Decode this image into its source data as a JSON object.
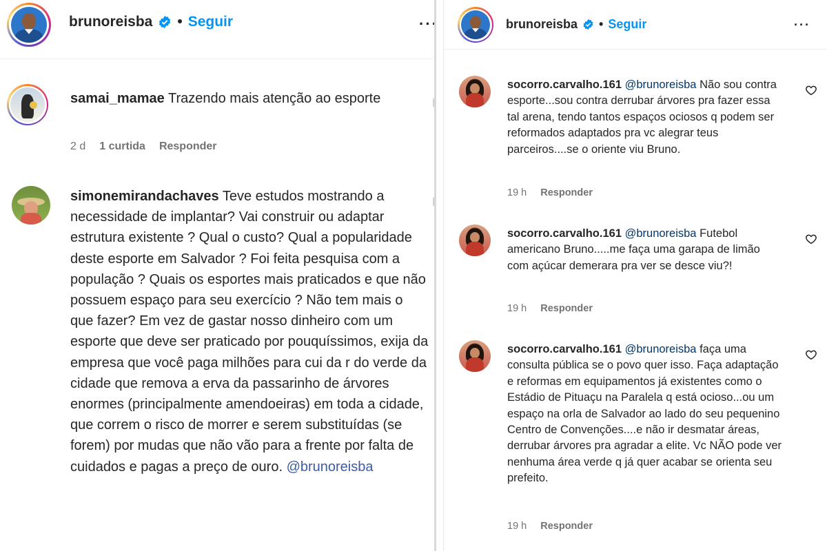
{
  "left": {
    "header": {
      "username": "brunoreisba",
      "dot": "•",
      "follow_label": "Seguir",
      "more": "···"
    },
    "comments": [
      {
        "username": "samai_mamae",
        "text": "Trazendo mais atenção ao esporte",
        "age": "2 d",
        "likes": "1 curtida",
        "reply_label": "Responder"
      },
      {
        "username": "simonemirandachaves",
        "text": "Teve estudos mostrando a necessidade de implantar? Vai construir ou adaptar estrutura existente ? Qual o custo? Qual a popularidade deste esporte em Salvador ? Foi feita pesquisa com a população ? Quais os esportes mais praticados e que não possuem espaço para seu exercício ? Não tem mais o que fazer? Em vez de gastar nosso dinheiro com um esporte que deve ser praticado por pouquíssimos, exija da empresa que você paga milhões para cui da r do verde da cidade que remova a erva da passarinho de árvores enormes (principalmente amendoeiras) em toda a cidade, que correm o risco de morrer e serem substituídas (se forem) por mudas que não vão para a frente por falta de cuidados e pagas a preço de ouro.",
        "mention": "@brunoreisba"
      }
    ]
  },
  "right": {
    "header": {
      "username": "brunoreisba",
      "dot": "•",
      "follow_label": "Seguir",
      "more": "···"
    },
    "comments": [
      {
        "username": "socorro.carvalho.161",
        "mention": "@brunoreisba",
        "text": "Não sou contra esporte...sou contra derrubar árvores pra fazer essa tal arena, tendo tantos espaços ociosos q podem ser reformados adaptados pra vc alegrar teus parceiros....se o oriente viu Bruno.",
        "age": "19 h",
        "reply_label": "Responder"
      },
      {
        "username": "socorro.carvalho.161",
        "mention": "@brunoreisba",
        "text": "Futebol americano Bruno.....me faça uma garapa de limão com açúcar demerara pra ver se desce viu?!",
        "age": "19 h",
        "reply_label": "Responder"
      },
      {
        "username": "socorro.carvalho.161",
        "mention": "@brunoreisba",
        "text": "faça uma consulta pública se o povo quer isso. Faça adaptação e reformas em equipamentos já existentes como o Estádio de Pituaçu na Paralela q está ocioso...ou um espaço na orla de Salvador ao lado do seu pequenino Centro de Convenções....e não ir desmatar áreas, derrubar árvores pra agradar a elite. Vc NÃO pode ver nenhuma área verde q já quer acabar se orienta seu prefeito.",
        "age": "19 h",
        "reply_label": "Responder"
      }
    ]
  },
  "colors": {
    "follow": "#0095f6",
    "verified": "#0095f6",
    "meta": "#737373",
    "mention": "#00376b"
  },
  "icons": [
    "verified-badge-icon",
    "more-options-icon",
    "heart-icon"
  ]
}
